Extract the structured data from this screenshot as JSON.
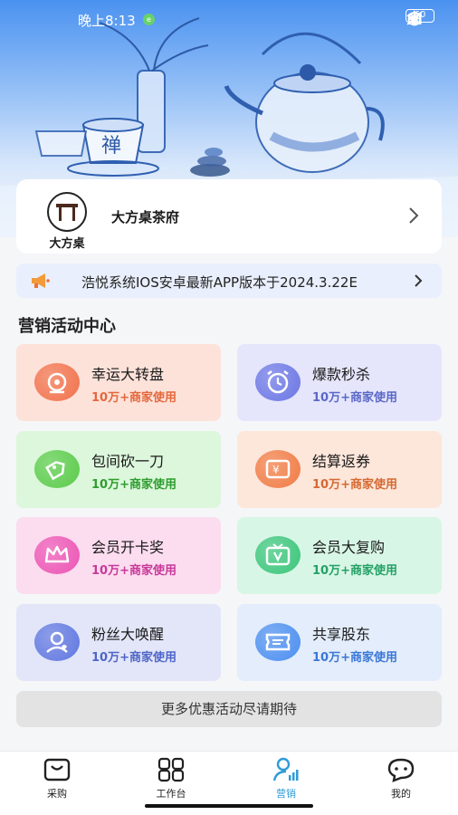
{
  "status_bar": {
    "time": "晚上8:13",
    "battery": "60"
  },
  "store": {
    "logo_text": "大方桌",
    "name": "大方桌茶府"
  },
  "notice": {
    "text": "浩悦系统IOS安卓最新APP版本于2024.3.22E"
  },
  "section": {
    "title": "营销活动中心"
  },
  "activities": [
    {
      "title": "幸运大转盘",
      "subtitle": "10万+商家使用",
      "icon": "camera-icon",
      "bg": "#fde2da",
      "sub_color": "#e3683c",
      "icon_color": "#f1724c"
    },
    {
      "title": "爆款秒杀",
      "subtitle": "10万+商家使用",
      "icon": "alarm-clock-icon",
      "bg": "#e5e6fb",
      "sub_color": "#5b68c8",
      "icon_color": "#6b76e4"
    },
    {
      "title": "包间砍一刀",
      "subtitle": "10万+商家使用",
      "icon": "coupon-cut-icon",
      "bg": "#dcf7dc",
      "sub_color": "#2f9d2f",
      "icon_color": "#5bcb4a"
    },
    {
      "title": "结算返券",
      "subtitle": "10万+商家使用",
      "icon": "yen-ticket-icon",
      "bg": "#fde6da",
      "sub_color": "#d46a32",
      "icon_color": "#f07c45"
    },
    {
      "title": "会员开卡奖",
      "subtitle": "10万+商家使用",
      "icon": "crown-icon",
      "bg": "#fcdcef",
      "sub_color": "#c8399a",
      "icon_color": "#ec55b5"
    },
    {
      "title": "会员大复购",
      "subtitle": "10万+商家使用",
      "icon": "tv-v-icon",
      "bg": "#d8f6e6",
      "sub_color": "#24a166",
      "icon_color": "#3cc57b"
    },
    {
      "title": "粉丝大唤醒",
      "subtitle": "10万+商家使用",
      "icon": "user-heart-icon",
      "bg": "#e2e6f8",
      "sub_color": "#4f65c8",
      "icon_color": "#6077e0"
    },
    {
      "title": "共享股东",
      "subtitle": "10万+商家使用",
      "icon": "ticket-icon",
      "bg": "#e3edfb",
      "sub_color": "#3b77d6",
      "icon_color": "#4b8ef0"
    }
  ],
  "more_button": "更多优惠活动尽请期待",
  "tabs": [
    {
      "label": "采购",
      "icon": "shopping-bag-icon",
      "active": false
    },
    {
      "label": "工作台",
      "icon": "grid-icon",
      "active": false
    },
    {
      "label": "营销",
      "icon": "user-chart-icon",
      "active": true
    },
    {
      "label": "我的",
      "icon": "chat-face-icon",
      "active": false
    }
  ],
  "colors": {
    "accent": "#2e9bd8",
    "hero_top": "#4a92f0"
  }
}
